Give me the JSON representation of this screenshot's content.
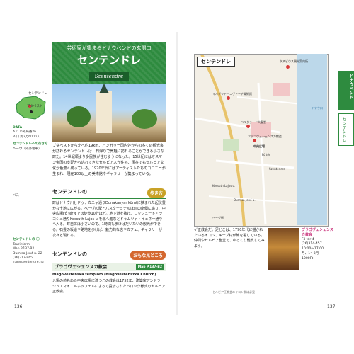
{
  "left": {
    "banner_kicker": "芸術家が集まるドナウベンドの玄関口",
    "banner_title": "センテンドレ",
    "banner_tag": "Szentendre",
    "side": {
      "map_label_budapest": "ブダペスト",
      "map_label_szentendre": "センテンドレ",
      "data_heading": "DATA",
      "area_code_label": "A.D",
      "area_code_value": "市外局番26",
      "population_label": "人口",
      "population_value": "約2万6000人",
      "access_heading": "センテンドレへの行き方",
      "hev_label": "ヘーヴ（郊外電車）",
      "bus_label": "バス",
      "tourinform_heading": "センテンドレの ⓘ",
      "tourinform_name": "Tourinform",
      "tourinform_map": "Map P.137-B2",
      "tourinform_address": "Dumtsa Jenő u. 22",
      "tourinform_tel": "(26)317-965",
      "tourinform_url": "iranyszentendre.hu"
    },
    "lead": "ブダペストから北へ約19km、ハンガリー国内外からの多くの観光客が訪れるセンテンドレは、日帰りで気軽に訪れることができる小さな町だ。14世紀頃より多民族が住むようになった。15世紀にはオスマン帝国の支配から逃れてきたセルビア人が住み、現在でもセルビア文化が色濃く残っている。1920年代にはアーティストたちのコロニーが生まれ、現在100以上の美術館やギャラリーが集まっている。",
    "walk_heading": "センテンドレの",
    "walk_badge": "歩き方",
    "walk_body": "町はドナウ川とドゥナカニャ通りDunakanyar körútに挟まれた起伏豊かな土地に広がる。ヘーヴの駅とバスターミナルは町の南側にあり、中央広場Fő térまでは徒歩10分ほど。地下道を抜け、コッシュート・ラヨシュ通りKossuth Lajos u.を北へ進むとドゥムツァ・イェネー通りへ入る。町自体は小さいので、1時間も歩けばだいたいの観光ができる。石畳の坂道や路地を歩けば、魅力的な店やカフェ、ギャラリーが次々と現れる。",
    "sights_heading": "センテンドレの",
    "sights_badge": "おもな見どころ",
    "spot_name": "ブラゴヴェシェンスカ教会",
    "spot_ref": "Map P.137-B2",
    "spot_name_latin": "Blagovestenska templom (Blagovestenszka Church)",
    "spot_body": "入場の値もある中央広場に建つこの教会は1752年、建築家アンドラーシュ・マイエルホッフェルによって設計されたバロック様式のセルビア正教会。",
    "page_number": "136"
  },
  "right": {
    "map_title": "センテンドレ",
    "map_labels": [
      "ダヌビウス観光案内所",
      "ドナウ川",
      "マルギット・コヴァーチ美術館",
      "ベルグラード大聖堂",
      "ブラゴヴェシェンスカ教会",
      "中央広場",
      "Szentendre",
      "Kossuth Lajos u.",
      "Dumtsa Jenő u.",
      "Fő tér",
      "ヘーヴ駅"
    ],
    "map_caption": "セルビア正教会のイコン群は必見",
    "body": "ゲ正教会だ。足どこは、1790年代に描かれたいるイコン、キープ村が飾を覆している。仲間やセルビア聖堂で、ゆっくり鑑賞してみよう。",
    "info_heading": "ブラゴヴェシェンスカ教会",
    "info_address": "Fő tér 4",
    "info_tel": "(26)314-457",
    "info_hours": "10:00〜17:00",
    "info_closed": "月、1〜3月",
    "info_fee": "1000Ft",
    "tab_main": "ドナウベンド",
    "tab_sub": "センテンドレ",
    "page_number": "137"
  }
}
